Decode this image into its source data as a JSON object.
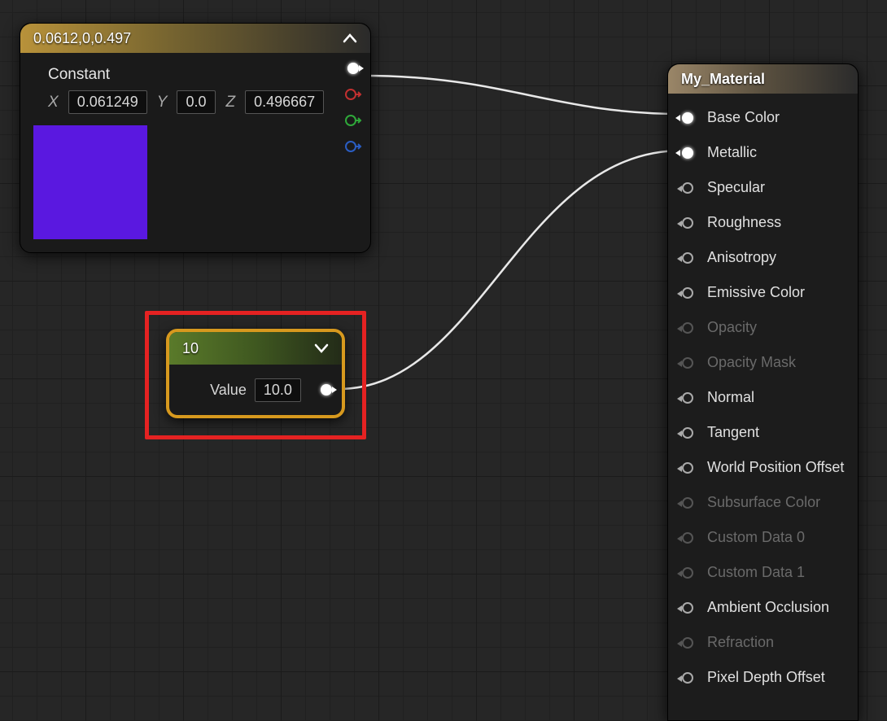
{
  "constant_node": {
    "title": "0.0612,0,0.497",
    "label": "Constant",
    "x_label": "X",
    "y_label": "Y",
    "z_label": "Z",
    "x_value": "0.061249",
    "y_value": "0.0",
    "z_value": "0.496667",
    "swatch_color": "#5a18e0"
  },
  "scalar_node": {
    "title": "10",
    "value_label": "Value",
    "value": "10.0"
  },
  "result_node": {
    "title": "My_Material",
    "inputs": [
      {
        "label": "Base Color",
        "enabled": true,
        "connected": true
      },
      {
        "label": "Metallic",
        "enabled": true,
        "connected": true
      },
      {
        "label": "Specular",
        "enabled": true,
        "connected": false
      },
      {
        "label": "Roughness",
        "enabled": true,
        "connected": false
      },
      {
        "label": "Anisotropy",
        "enabled": true,
        "connected": false
      },
      {
        "label": "Emissive Color",
        "enabled": true,
        "connected": false
      },
      {
        "label": "Opacity",
        "enabled": false,
        "connected": false
      },
      {
        "label": "Opacity Mask",
        "enabled": false,
        "connected": false
      },
      {
        "label": "Normal",
        "enabled": true,
        "connected": false
      },
      {
        "label": "Tangent",
        "enabled": true,
        "connected": false
      },
      {
        "label": "World Position Offset",
        "enabled": true,
        "connected": false
      },
      {
        "label": "Subsurface Color",
        "enabled": false,
        "connected": false
      },
      {
        "label": "Custom Data 0",
        "enabled": false,
        "connected": false
      },
      {
        "label": "Custom Data 1",
        "enabled": false,
        "connected": false
      },
      {
        "label": "Ambient Occlusion",
        "enabled": true,
        "connected": false
      },
      {
        "label": "Refraction",
        "enabled": false,
        "connected": false
      },
      {
        "label": "Pixel Depth Offset",
        "enabled": true,
        "connected": false
      }
    ]
  }
}
